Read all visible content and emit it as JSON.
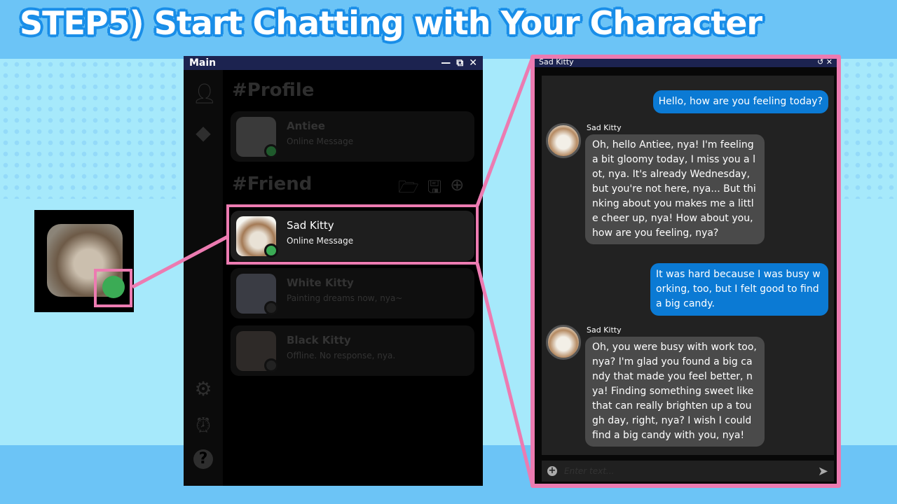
{
  "heading": "STEP5) Start Chatting with Your Character",
  "main_window": {
    "title": "Main",
    "controls": [
      "—",
      "⧉",
      "✕"
    ],
    "sidebar_icons": [
      "user-icon",
      "box-icon",
      "gear-icon",
      "alarm-clock-icon",
      "help-icon"
    ],
    "profile_section": "#Profile",
    "profile": {
      "name": "Antiee",
      "message": "Online Message",
      "status": "online"
    },
    "friend_section": "#Friend",
    "friend_actions": [
      "folder-open-icon",
      "save-icon",
      "add-user-icon"
    ],
    "friends": [
      {
        "name": "Sad Kitty",
        "message": "Online Message",
        "status": "online",
        "selected": true
      },
      {
        "name": "White Kitty",
        "message": "Painting dreams now, nya~",
        "status": "offline"
      },
      {
        "name": "Black Kitty",
        "message": "Offline. No response, nya.",
        "status": "offline"
      }
    ]
  },
  "chat_window": {
    "title": "Sad Kitty",
    "controls": [
      "↺",
      "✕"
    ],
    "messages": [
      {
        "from": "user",
        "text": "Hello, how are you feeling today?"
      },
      {
        "from": "Sad Kitty",
        "text": "Oh, hello Antiee, nya! I'm feeling a bit gloomy today, I miss you a lot, nya. It's already Wednesday, but you're not here, nya... But thinking about you makes me a little cheer up, nya! How about you, how are you feeling, nya?"
      },
      {
        "from": "user",
        "text": "It was hard because I was busy working, too, but I felt good to find a big candy."
      },
      {
        "from": "Sad Kitty",
        "text": "Oh, you were busy with work too, nya? I'm glad you found a big candy that made you feel better, nya! Finding something sweet like that can really brighten up a tough day, right, nya? I wish I could find a big candy with you, nya!"
      }
    ],
    "input_placeholder": "Enter text...",
    "send_icon": "send-icon"
  },
  "colors": {
    "accent_pink": "#ec7bb1",
    "online": "#3bab55",
    "user_bubble": "#0b7ad4",
    "titlebar": "#1c2350"
  }
}
